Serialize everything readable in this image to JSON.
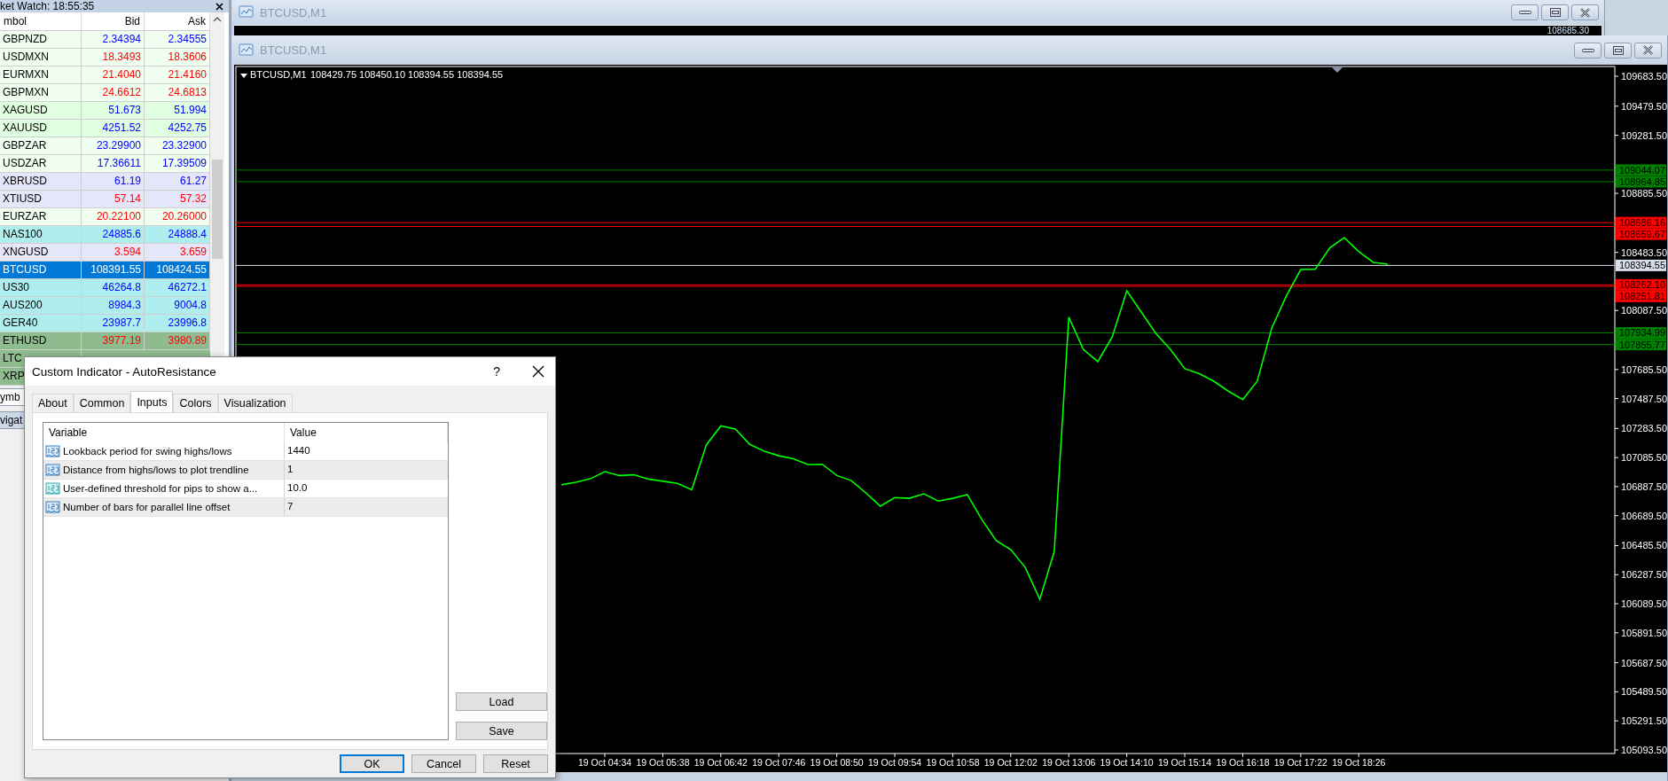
{
  "market_watch": {
    "title": "ket Watch: 18:55:35",
    "columns": [
      "mbol",
      "Bid",
      "Ask"
    ],
    "rows": [
      {
        "symbol": "GBPNZD",
        "bid": "2.34394",
        "ask": "2.34555",
        "color": "#f0fff0",
        "rising": true,
        "selected": false
      },
      {
        "symbol": "USDMXN",
        "bid": "18.3493",
        "ask": "18.3606",
        "color": "#f0fff0",
        "rising": false,
        "selected": false
      },
      {
        "symbol": "EURMXN",
        "bid": "21.4040",
        "ask": "21.4160",
        "color": "#f0fff0",
        "rising": false,
        "selected": false
      },
      {
        "symbol": "GBPMXN",
        "bid": "24.6612",
        "ask": "24.6813",
        "color": "#f0fff0",
        "rising": false,
        "selected": false
      },
      {
        "symbol": "XAGUSD",
        "bid": "51.673",
        "ask": "51.994",
        "color": "#e0ffe0",
        "rising": true,
        "selected": false
      },
      {
        "symbol": "XAUUSD",
        "bid": "4251.52",
        "ask": "4252.75",
        "color": "#e0ffe0",
        "rising": true,
        "selected": false
      },
      {
        "symbol": "GBPZAR",
        "bid": "23.29900",
        "ask": "23.32900",
        "color": "#f0fff0",
        "rising": true,
        "selected": false
      },
      {
        "symbol": "USDZAR",
        "bid": "17.36611",
        "ask": "17.39509",
        "color": "#f0fff0",
        "rising": true,
        "selected": false
      },
      {
        "symbol": "XBRUSD",
        "bid": "61.19",
        "ask": "61.27",
        "color": "#e6e6fa",
        "rising": true,
        "selected": false
      },
      {
        "symbol": "XTIUSD",
        "bid": "57.14",
        "ask": "57.32",
        "color": "#e6e6fa",
        "rising": false,
        "selected": false
      },
      {
        "symbol": "EURZAR",
        "bid": "20.22100",
        "ask": "20.26000",
        "color": "#f0fff0",
        "rising": false,
        "selected": false
      },
      {
        "symbol": "NAS100",
        "bid": "24885.6",
        "ask": "24888.4",
        "color": "#afeeee",
        "rising": true,
        "selected": false
      },
      {
        "symbol": "XNGUSD",
        "bid": "3.594",
        "ask": "3.659",
        "color": "#e6e6fa",
        "rising": false,
        "selected": false
      },
      {
        "symbol": "BTCUSD",
        "bid": "108391.55",
        "ask": "108424.55",
        "selected": true
      },
      {
        "symbol": "US30",
        "bid": "46264.8",
        "ask": "46272.1",
        "color": "#afeeee",
        "rising": true,
        "selected": false
      },
      {
        "symbol": "AUS200",
        "bid": "8984.3",
        "ask": "9004.8",
        "color": "#afeeee",
        "rising": true,
        "selected": false
      },
      {
        "symbol": "GER40",
        "bid": "23987.7",
        "ask": "23996.8",
        "color": "#afeeee",
        "rising": true,
        "selected": false
      },
      {
        "symbol": "ETHUSD",
        "bid": "3977.19",
        "ask": "3980.89",
        "color": "#8fbc8f",
        "rising": false,
        "selected": false
      },
      {
        "symbol": "LTC",
        "color": "#8fbc8f",
        "selected": false
      },
      {
        "symbol": "XRP",
        "color": "#8fbc8f",
        "selected": false
      }
    ]
  },
  "side_tabs": [
    "ymb",
    "vigat"
  ],
  "chart_windows": [
    {
      "title": "BTCUSD,M1",
      "price_tag": "108685.30"
    },
    {
      "title": "BTCUSD,M1",
      "symbol_label": "BTCUSD,M1",
      "ohlc": "108429.75 108450.10 108394.55 108394.55",
      "chart_data": {
        "type": "line",
        "ylim": [
          105069,
          109750
        ],
        "ref_lines": [
          {
            "axis": "y",
            "value": 109044.07,
            "label": "109044.07",
            "color": "#008000"
          },
          {
            "axis": "y",
            "value": 108964.85,
            "label": "108964.85",
            "color": "#008000"
          },
          {
            "axis": "y",
            "value": 108686.16,
            "label": "108686.16",
            "color": "#ff0000"
          },
          {
            "axis": "y",
            "value": 108659.67,
            "label": "108659.67",
            "color": "#ff0000"
          },
          {
            "axis": "y",
            "value": 108394.55,
            "label": "108394.55",
            "color": "#d8dee8"
          },
          {
            "axis": "y",
            "value": 108262.1,
            "label": "108262.10",
            "color": "#ff0000"
          },
          {
            "axis": "y",
            "value": 108251.81,
            "label": "108251.81",
            "color": "#ff0000"
          },
          {
            "axis": "y",
            "value": 107934.99,
            "label": "107934.99",
            "color": "#008000"
          },
          {
            "axis": "y",
            "value": 107855.77,
            "label": "107855.77",
            "color": "#008000"
          }
        ],
        "categories": [
          null,
          null,
          null,
          "19 Oct 04:34",
          null,
          null,
          null,
          "19 Oct 05:38",
          null,
          null,
          null,
          "19 Oct 06:42",
          null,
          null,
          null,
          "19 Oct 07:46",
          null,
          null,
          null,
          "19 Oct 08:50",
          null,
          null,
          null,
          "19 Oct 09:54",
          null,
          null,
          null,
          "19 Oct 10:58",
          null,
          null,
          null,
          "19 Oct 12:02",
          null,
          null,
          null,
          "19 Oct 13:06",
          null,
          null,
          null,
          "19 Oct 14:10",
          null,
          null,
          null,
          "19 Oct 15:14",
          null,
          null,
          null,
          "19 Oct 16:18",
          null,
          null,
          null,
          "19 Oct 17:22",
          null,
          null,
          null,
          "19 Oct 18:26",
          null,
          null
        ],
        "series": [
          {
            "color": "#00ff00",
            "values": [
              106900,
              106917,
              106941,
              106990,
              106963,
              106968,
              106939,
              106924,
              106910,
              106866,
              107171,
              107301,
              107280,
              107175,
              107128,
              107098,
              107077,
              107038,
              107040,
              106963,
              106929,
              106845,
              106755,
              106813,
              106808,
              106838,
              106789,
              106808,
              106833,
              106663,
              106519,
              106458,
              106337,
              106120,
              106446,
              108041,
              107823,
              107739,
              107908,
              108221,
              108077,
              107932,
              107823,
              107691,
              107657,
              107606,
              107538,
              107480,
              107606,
              107968,
              108185,
              108367,
              108369,
              108515,
              108584,
              108488,
              108415,
              108403
            ]
          }
        ],
        "yticks": [
          {
            "value": 109683.5,
            "label": "109683.50"
          },
          {
            "value": 109479.5,
            "label": "109479.50"
          },
          {
            "value": 109281.5,
            "label": "109281.50"
          },
          {
            "value": 108885.5,
            "label": "108885.50"
          },
          {
            "value": 108483.5,
            "label": "108483.50"
          },
          {
            "value": 108087.5,
            "label": "108087.50"
          },
          {
            "value": 107685.5,
            "label": "107685.50"
          },
          {
            "value": 107487.5,
            "label": "107487.50"
          },
          {
            "value": 107283.5,
            "label": "107283.50"
          },
          {
            "value": 107085.5,
            "label": "107085.50"
          },
          {
            "value": 106887.5,
            "label": "106887.50"
          },
          {
            "value": 106689.5,
            "label": "106689.50"
          },
          {
            "value": 106485.5,
            "label": "106485.50"
          },
          {
            "value": 106287.5,
            "label": "106287.50"
          },
          {
            "value": 106089.5,
            "label": "106089.50"
          },
          {
            "value": 105891.5,
            "label": "105891.50"
          },
          {
            "value": 105687.5,
            "label": "105687.50"
          },
          {
            "value": 105489.5,
            "label": "105489.50"
          },
          {
            "value": 105291.5,
            "label": "105291.50"
          },
          {
            "value": 105093.5,
            "label": "105093.50"
          }
        ]
      }
    }
  ],
  "dialog": {
    "title": "Custom Indicator - AutoResistance",
    "help": "?",
    "tabs": [
      {
        "label": "About",
        "selected": false
      },
      {
        "label": "Common",
        "selected": false
      },
      {
        "label": "Inputs",
        "selected": true
      },
      {
        "label": "Colors",
        "selected": false
      },
      {
        "label": "Visualization",
        "selected": false
      }
    ],
    "columns": [
      "Variable",
      "Value"
    ],
    "rows": [
      {
        "kind": "int",
        "variable": "Lookback period for swing highs/lows",
        "value": "1440"
      },
      {
        "kind": "int",
        "variable": "Distance from highs/lows to plot trendline",
        "value": "1"
      },
      {
        "kind": "double",
        "variable": "User-defined threshold for pips to show a...",
        "value": "10.0"
      },
      {
        "kind": "int",
        "variable": "Number of bars for parallel line offset",
        "value": "7"
      }
    ],
    "side_buttons": [
      "Load",
      "Save"
    ],
    "buttons": [
      {
        "label": "OK",
        "default": true
      },
      {
        "label": "Cancel",
        "default": false
      },
      {
        "label": "Reset",
        "default": false
      }
    ]
  }
}
